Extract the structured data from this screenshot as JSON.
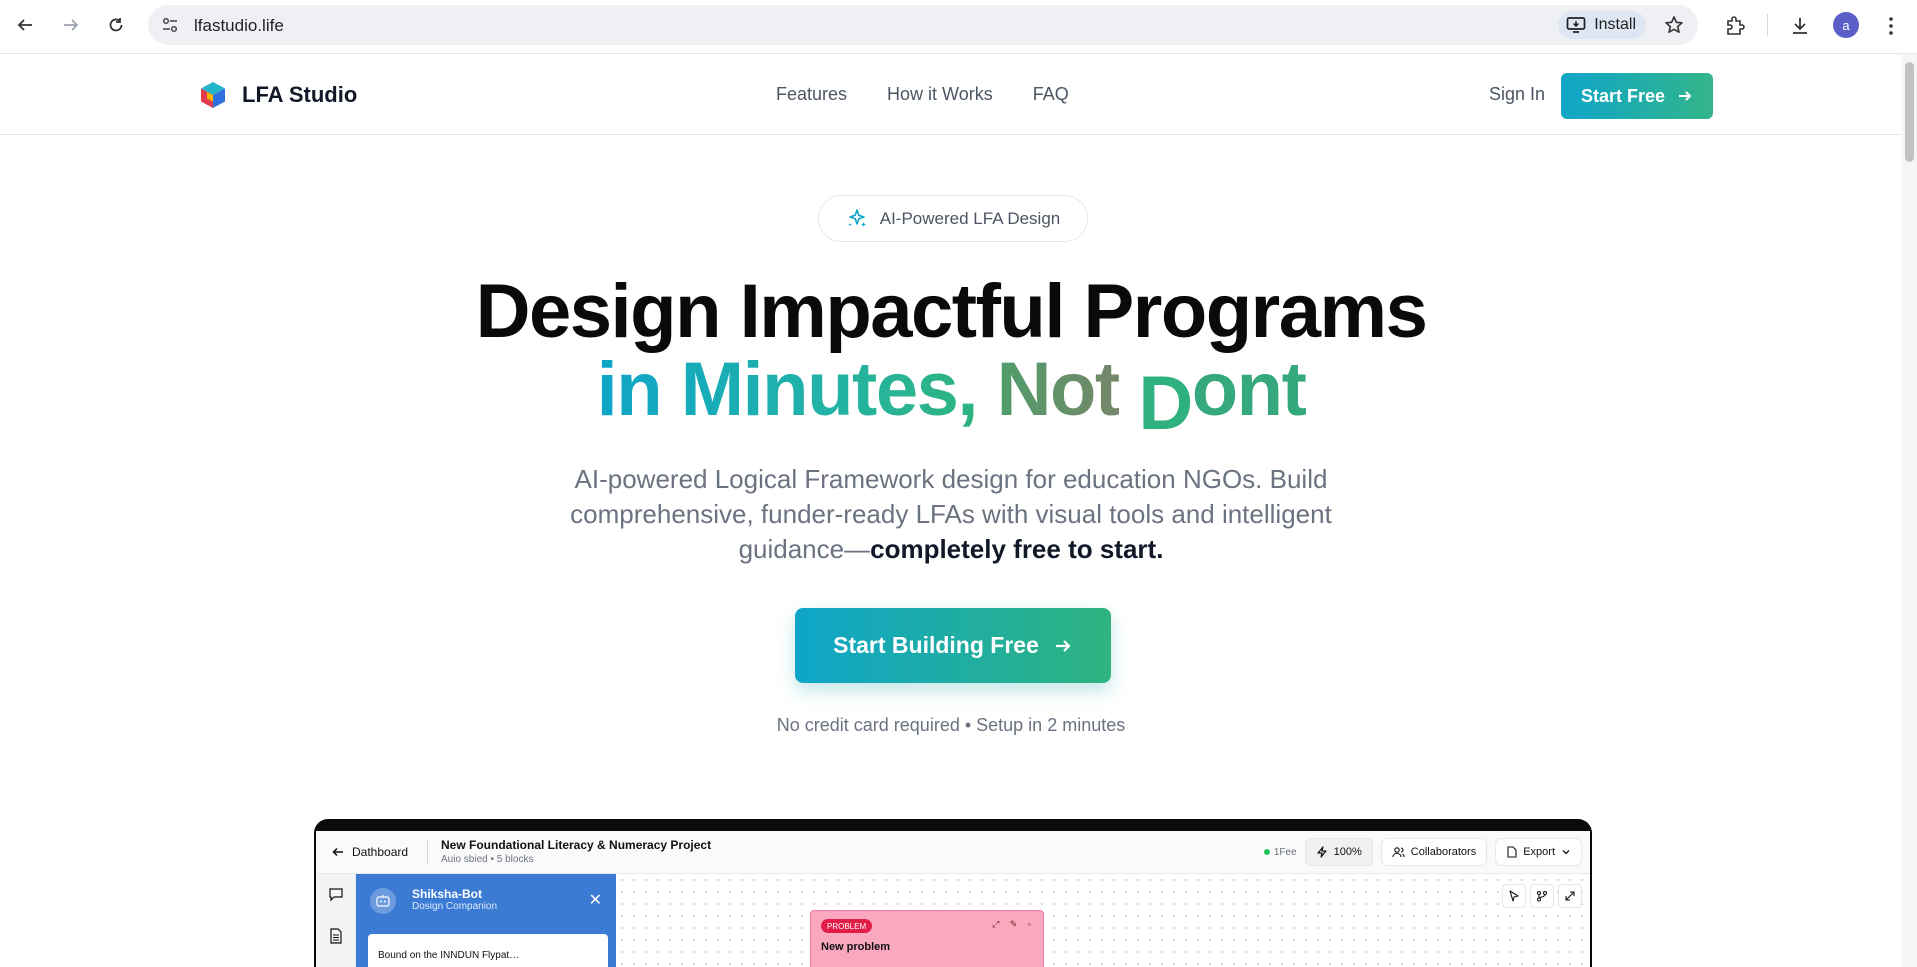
{
  "browser": {
    "url": "lfastudio.life",
    "install_label": "Install",
    "avatar_letter": "a"
  },
  "header": {
    "brand": "LFA Studio",
    "nav": [
      "Features",
      "How it Works",
      "FAQ"
    ],
    "sign_in": "Sign In",
    "start_free": "Start Free"
  },
  "hero": {
    "badge": "AI-Powered LFA Design",
    "title_line1": "Design Impactful Programs",
    "title_line2_part1": "in Minutes,",
    "title_line2_part2": "Not",
    "title_line2_d": "D",
    "title_line2_ont": "ont",
    "description": "AI-powered Logical Framework design for education NGOs. Build comprehensive, funder-ready LFAs with visual tools and intelligent guidance—",
    "description_bold": "completely free to start.",
    "cta": "Start Building Free",
    "note": "No credit card required • Setup in 2 minutes"
  },
  "preview": {
    "back_label": "Dathboard",
    "project_title": "New Foundational Literacy & Numeracy Project",
    "project_meta": "Auio sbied  •  5 blocks",
    "status": "1Fee",
    "zoom": "100%",
    "collaborators": "Collaborators",
    "export": "Export",
    "bot_name": "Shiksha-Bot",
    "bot_subtitle": "Dosign Companion",
    "bot_message": "Bound on the INNDUN Flypat…",
    "card_tag": "PROBLEM",
    "card_title": "New problem"
  },
  "colors": {
    "accent_start": "#0ea5c9",
    "accent_end": "#2fb47f"
  }
}
